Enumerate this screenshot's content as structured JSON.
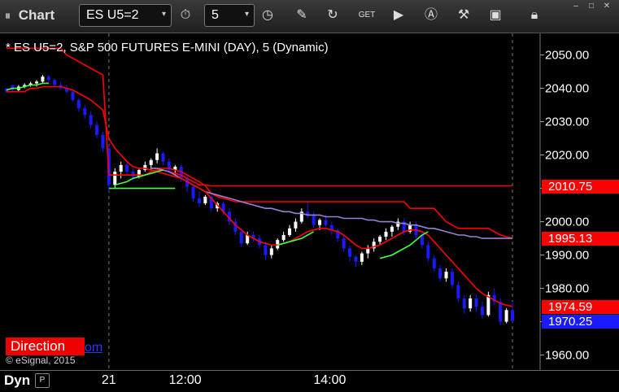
{
  "toolbar": {
    "title": "Chart",
    "symbol": "ES U5=2",
    "interval": "5",
    "dropdown_chevron": "▾",
    "icons": [
      "clock-icon",
      "pencil-icon",
      "refresh-icon",
      "get-icon",
      "play-icon",
      "alert-icon",
      "wrench-icon",
      "camera-icon",
      "lock-icon"
    ]
  },
  "chart_data": {
    "type": "line",
    "title": "* ES U5=2, S&P 500 FUTURES E-MINI (DAY), 5 (Dynamic)",
    "ylim": [
      1956,
      2056
    ],
    "y_ticks": [
      2050.0,
      2040.0,
      2030.0,
      2020.0,
      2010.0,
      2000.0,
      1990.0,
      1980.0,
      1970.0,
      1960.0
    ],
    "y_tick_labels": [
      "2050.00",
      "2040.00",
      "2030.00",
      "2020.00",
      "2010.00",
      "2000.00",
      "1990.00",
      "1980.00",
      "1970.00",
      "1960.00"
    ],
    "x_tick_labels": [
      "21",
      "12:00",
      "14:00"
    ],
    "bars": [
      [
        2040,
        2039.5,
        2038.5,
        2039
      ],
      [
        2041,
        2040,
        2039,
        2039.5
      ],
      [
        2039.5,
        2041,
        2039,
        2040.5
      ],
      [
        2040.5,
        2041.5,
        2040,
        2041
      ],
      [
        2041,
        2042,
        2040.5,
        2041.5
      ],
      [
        2041.5,
        2042.5,
        2040.5,
        2042
      ],
      [
        2042,
        2044,
        2041.5,
        2043.5
      ],
      [
        2043.5,
        2044,
        2042,
        2042.5
      ],
      [
        2042.5,
        2043,
        2040.5,
        2041
      ],
      [
        2041,
        2042,
        2039.5,
        2040
      ],
      [
        2040,
        2041,
        2038.5,
        2039
      ],
      [
        2039,
        2039.5,
        2036,
        2036.5
      ],
      [
        2036.5,
        2037,
        2033,
        2034
      ],
      [
        2034,
        2035,
        2031,
        2032
      ],
      [
        2032,
        2033,
        2028,
        2029
      ],
      [
        2029,
        2030,
        2025,
        2026
      ],
      [
        2026,
        2027,
        2021,
        2022
      ],
      [
        2022,
        2023,
        2009,
        2011
      ],
      [
        2011,
        2016,
        2010,
        2015
      ],
      [
        2015,
        2018,
        2013,
        2017
      ],
      [
        2017,
        2018,
        2014,
        2015
      ],
      [
        2015,
        2016,
        2012.5,
        2013.5
      ],
      [
        2013.5,
        2016,
        2013,
        2015.5
      ],
      [
        2015.5,
        2018,
        2015,
        2017
      ],
      [
        2017,
        2019,
        2015.5,
        2018.5
      ],
      [
        2018.5,
        2022,
        2017.5,
        2020.5
      ],
      [
        2020.5,
        2021,
        2017,
        2018
      ],
      [
        2018,
        2019,
        2014.5,
        2015.5
      ],
      [
        2015.5,
        2017,
        2014,
        2016.5
      ],
      [
        2016.5,
        2017,
        2012,
        2013
      ],
      [
        2013,
        2014,
        2009,
        2010.5
      ],
      [
        2010.5,
        2011,
        2006,
        2007
      ],
      [
        2007,
        2009,
        2004.5,
        2005.5
      ],
      [
        2005.5,
        2008,
        2005,
        2007.5
      ],
      [
        2007.5,
        2008,
        2003,
        2004
      ],
      [
        2004,
        2006,
        2003,
        2005.5
      ],
      [
        2005.5,
        2006,
        2002,
        2003
      ],
      [
        2003,
        2004,
        1999,
        2000
      ],
      [
        2000,
        2001,
        1996,
        1997
      ],
      [
        1997,
        1998,
        1992.5,
        1993.5
      ],
      [
        1993.5,
        1997,
        1993,
        1996
      ],
      [
        1996,
        1997,
        1994,
        1995
      ],
      [
        1995,
        1996,
        1992,
        1993
      ],
      [
        1993,
        1994,
        1988.5,
        1990
      ],
      [
        1990,
        1993,
        1989,
        1992
      ],
      [
        1992,
        1995,
        1991.5,
        1994.5
      ],
      [
        1994.5,
        1997,
        1994,
        1996
      ],
      [
        1996,
        1999,
        1995.5,
        1998
      ],
      [
        1998,
        2001,
        1997,
        2000
      ],
      [
        2000,
        2004,
        1999.5,
        2003
      ],
      [
        2003,
        2006,
        2001,
        2002
      ],
      [
        2002,
        2003,
        1998,
        1999
      ],
      [
        1999,
        2001,
        1997.5,
        2000.5
      ],
      [
        2000.5,
        2002,
        1998.5,
        1999
      ],
      [
        1999,
        2000,
        1996,
        1997.5
      ],
      [
        1997.5,
        1998,
        1994,
        1995
      ],
      [
        1995,
        1996,
        1991,
        1992
      ],
      [
        1992,
        1993,
        1988,
        1989.5
      ],
      [
        1989.5,
        1990,
        1986.5,
        1988
      ],
      [
        1988,
        1991,
        1987,
        1990.5
      ],
      [
        1990.5,
        1993,
        1989,
        1992
      ],
      [
        1992,
        1995,
        1991,
        1994
      ],
      [
        1994,
        1996,
        1993,
        1995.5
      ],
      [
        1995.5,
        1998,
        1994.5,
        1997
      ],
      [
        1997,
        1999,
        1995.5,
        1998.5
      ],
      [
        1998.5,
        2001,
        1997.5,
        2000
      ],
      [
        2000,
        2001,
        1996,
        1997
      ],
      [
        1997,
        2000,
        1996.5,
        1999
      ],
      [
        1999,
        2000,
        1995,
        1996
      ],
      [
        1996,
        1997,
        1992,
        1993
      ],
      [
        1993,
        1994,
        1988,
        1989
      ],
      [
        1989,
        1990,
        1985,
        1986
      ],
      [
        1986,
        1987,
        1982,
        1983
      ],
      [
        1983,
        1986,
        1982,
        1985
      ],
      [
        1985,
        1986,
        1980,
        1981
      ],
      [
        1981,
        1982,
        1976,
        1977
      ],
      [
        1977,
        1978,
        1972.5,
        1974
      ],
      [
        1974,
        1978,
        1973,
        1977
      ],
      [
        1977,
        1978,
        1973,
        1974.5
      ],
      [
        1974.5,
        1976,
        1971,
        1972
      ],
      [
        1972,
        1979,
        1971.5,
        1978
      ],
      [
        1978,
        1980,
        1975,
        1976
      ],
      [
        1976,
        1977,
        1969,
        1970
      ],
      [
        1970,
        1974,
        1969.5,
        1973.5
      ],
      [
        1973.5,
        1976,
        1970,
        1970.25
      ]
    ],
    "bar_times": [
      "09:30",
      "09:35",
      "09:40",
      "09:45",
      "09:50",
      "09:55",
      "10:00",
      "10:05",
      "10:10",
      "10:15",
      "10:20",
      "10:25",
      "10:30",
      "10:35",
      "10:40",
      "10:45",
      "10:50",
      "10:55",
      "11:00",
      "11:05",
      "11:10",
      "11:15",
      "11:20",
      "11:25",
      "11:30",
      "11:35",
      "11:40",
      "11:45",
      "11:50",
      "11:55",
      "12:00",
      "12:05",
      "12:10",
      "12:15",
      "12:20",
      "12:25",
      "12:30",
      "12:35",
      "12:40",
      "12:45",
      "12:50",
      "12:55",
      "13:00",
      "13:05",
      "13:10",
      "13:15",
      "13:20",
      "13:25",
      "13:30",
      "13:35",
      "13:40",
      "13:45",
      "13:50",
      "13:55",
      "14:00",
      "14:05",
      "14:10",
      "14:15",
      "14:20",
      "14:25",
      "14:30",
      "14:35",
      "14:40",
      "14:45",
      "14:50",
      "14:55",
      "15:00",
      "15:05",
      "15:10",
      "15:15",
      "15:20",
      "15:25",
      "15:30",
      "15:35",
      "15:40",
      "15:45",
      "15:50",
      "15:55",
      "16:00",
      "16:05",
      "16:10",
      "16:15",
      "16:20",
      "16:25",
      "16:30"
    ],
    "series": [
      {
        "color": "#ff0000",
        "values": [
          2052,
          2052,
          2052,
          2052,
          2052,
          2052,
          2052,
          2052,
          2052,
          2052,
          2050,
          2049,
          2048,
          2047,
          2046,
          2045,
          2044,
          2014,
          2014,
          2014,
          2014,
          2014,
          2014,
          2014,
          2015,
          2015.5,
          2015.5,
          2015,
          2014.5,
          2014,
          2013,
          2012,
          2011,
          2011,
          2010.75,
          2010.75,
          2010.75,
          2010.75,
          2010.75,
          2010.75,
          2010.75,
          2010.75,
          2010.75,
          2010.75,
          2010.75,
          2010.75,
          2010.75,
          2010.75,
          2010.75,
          2010.75,
          2010.75,
          2010.75,
          2010.75,
          2010.75,
          2010.75,
          2010.75,
          2010.75,
          2010.75,
          2010.75,
          2010.75,
          2010.75,
          2010.75,
          2010.75,
          2010.75,
          2010.75,
          2010.75,
          2010.75,
          2010.75,
          2010.75,
          2010.75,
          2010.75,
          2010.75,
          2010.75,
          2010.75,
          2010.75,
          2010.75,
          2010.75,
          2010.75,
          2010.75,
          2010.75,
          2010.75,
          2010.75,
          2010.75,
          2010.75,
          2010.75
        ]
      },
      {
        "color": "#ff0000",
        "values": [
          null,
          null,
          null,
          null,
          null,
          null,
          null,
          null,
          null,
          null,
          null,
          null,
          null,
          null,
          null,
          null,
          null,
          null,
          null,
          null,
          null,
          null,
          null,
          null,
          2016,
          2016,
          2016,
          2016,
          2015.5,
          2015,
          2014,
          2013,
          2012,
          2010.75,
          2008.5,
          2007.5,
          2007,
          2006.5,
          2006,
          2006,
          2006,
          2006,
          2006,
          2006,
          2006,
          2006,
          2006,
          2006,
          2006,
          2006,
          2006,
          2006,
          2006,
          2006,
          2006,
          2006,
          2006,
          2006,
          2006,
          2006,
          2006,
          2006,
          2006,
          2006,
          2006,
          2006,
          2006,
          2004,
          2004,
          2004,
          2004,
          2004,
          2002,
          2000,
          1999,
          1998,
          1998,
          1998,
          1998,
          1998,
          1998,
          1997,
          1996,
          1995.5,
          1995.13
        ]
      },
      {
        "color": "#9b7fd4",
        "values": [
          null,
          null,
          null,
          null,
          null,
          null,
          null,
          null,
          null,
          null,
          null,
          null,
          null,
          null,
          null,
          null,
          null,
          null,
          null,
          null,
          null,
          null,
          null,
          null,
          2016,
          2016,
          2015.5,
          2015,
          2014,
          2013,
          2012,
          2011,
          2010,
          2009,
          2008.5,
          2008,
          2007.5,
          2007,
          2006.5,
          2006,
          2005.5,
          2005,
          2004.5,
          2004,
          2004,
          2003.5,
          2003,
          2003,
          2002.5,
          2002.5,
          2002,
          2002,
          2002,
          2001.5,
          2001.5,
          2001.5,
          2001,
          2001,
          2001,
          2001,
          2000.5,
          2000.5,
          2000,
          2000,
          2000,
          1999.5,
          1999.5,
          1999,
          1999,
          1998.5,
          1998,
          1998,
          1997.5,
          1997,
          1996.5,
          1996,
          1996,
          1995.5,
          1995.5,
          1995,
          1995,
          1995,
          1995,
          1995,
          1995
        ]
      },
      {
        "color": "#ff0000",
        "values": [
          2039,
          2039,
          2039,
          2039,
          2040,
          2040,
          2040.5,
          2040.5,
          2040.5,
          2040.5,
          2040,
          2039.5,
          2038.5,
          2037.5,
          2036.5,
          2035,
          2033.5,
          2025,
          2022,
          2020,
          2018,
          2016.5,
          2016,
          2016,
          2015.5,
          2015,
          2014.5,
          2014,
          2013.5,
          2013,
          2012,
          2011,
          2010,
          2009,
          2007,
          2005,
          2003,
          2001,
          1999,
          1997.5,
          1996,
          1995,
          1994,
          1993.5,
          1993,
          1993,
          1993.5,
          1994,
          1995,
          1996,
          1997,
          1997.5,
          1998,
          1998,
          1997.5,
          1997,
          1996,
          1994.5,
          1993,
          1992,
          1992,
          1992.5,
          1993,
          1994,
          1995,
          1996,
          1997,
          1997.5,
          1997.5,
          1997,
          1996,
          1994,
          1992,
          1990,
          1988,
          1986,
          1984,
          1982,
          1980,
          1978.5,
          1977.5,
          1976.5,
          1975.5,
          1975,
          1974.59
        ]
      },
      {
        "color": "#44ff44",
        "values": [
          2039.5,
          2040,
          2040,
          2040.5,
          2041,
          2041,
          2041.5,
          2041.5,
          null,
          null,
          null,
          null,
          null,
          null,
          null,
          null,
          null,
          null,
          2011,
          2011.5,
          2012,
          2013,
          2013.5,
          2014,
          2014.5,
          2015,
          2015.5,
          null,
          null,
          null,
          null,
          null,
          null,
          null,
          null,
          null,
          null,
          null,
          null,
          null,
          null,
          null,
          null,
          null,
          null,
          1993,
          1993.5,
          1994,
          1994.5,
          1995,
          1996,
          1997,
          null,
          null,
          null,
          null,
          null,
          null,
          null,
          null,
          null,
          null,
          1989,
          1989.5,
          1990,
          1991,
          1992,
          1993,
          1994.5,
          1996,
          1997,
          null,
          null,
          null,
          null,
          null,
          null,
          null,
          null,
          null,
          null,
          null,
          null,
          null,
          null
        ]
      },
      {
        "color": "#44ff44",
        "values": [
          null,
          null,
          null,
          null,
          null,
          null,
          null,
          null,
          null,
          null,
          null,
          null,
          null,
          null,
          null,
          null,
          null,
          2010,
          2010,
          2010,
          2010,
          2010,
          2010,
          2010,
          2010,
          2010,
          2010,
          2010,
          2010,
          null,
          null,
          null,
          null,
          null,
          null,
          null,
          null,
          null,
          null,
          null,
          null,
          null,
          null,
          null,
          null,
          null,
          null,
          null,
          null,
          null,
          null,
          null,
          null,
          null,
          null,
          null,
          null,
          null,
          null,
          null,
          null,
          null,
          null,
          null,
          null,
          null,
          null,
          null,
          null,
          null,
          null,
          null,
          null,
          null,
          null,
          null,
          null,
          null,
          null,
          null,
          null,
          null,
          null,
          null,
          null
        ]
      }
    ],
    "price_tags": [
      {
        "label": "2010.75",
        "value": 2010.75,
        "color": "#ff0000"
      },
      {
        "label": "1995.13",
        "value": 1995.13,
        "color": "#ff0000"
      },
      {
        "label": "1974.59",
        "value": 1974.59,
        "color": "#ff0000"
      },
      {
        "label": "1970.25",
        "value": 1970.25,
        "color": "#1a1aff"
      }
    ],
    "up_color": "#ffffff",
    "down_color": "#1a1aff"
  },
  "indicator": {
    "label": "Direction",
    "suffix": "om"
  },
  "copyright": "© eSignal, 2015",
  "footer": {
    "label": "Dyn",
    "button": "P"
  }
}
